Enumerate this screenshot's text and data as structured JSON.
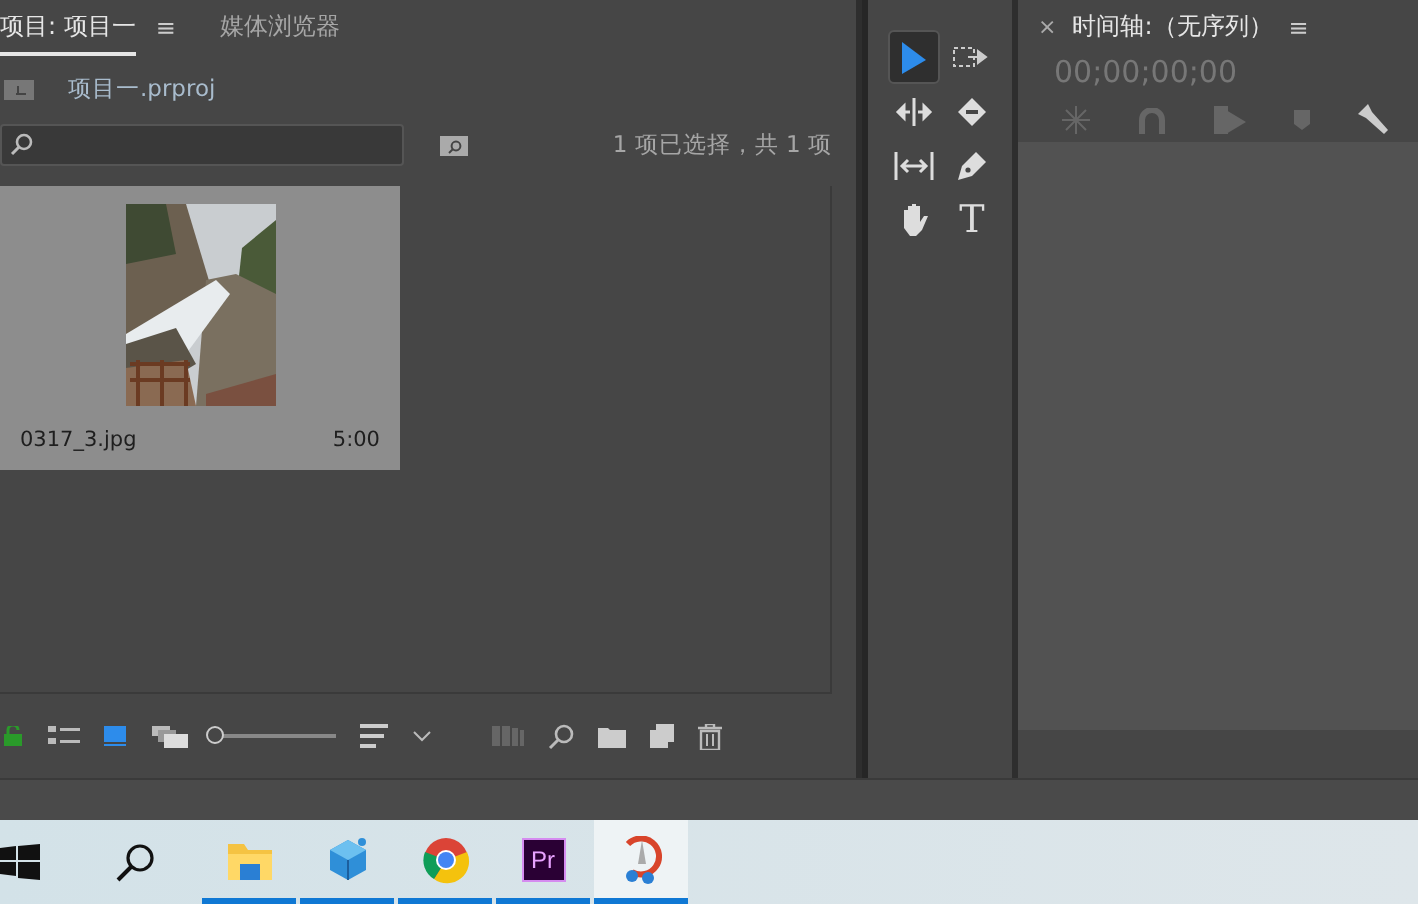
{
  "project_panel": {
    "tabs": [
      {
        "label": "项目: 项目一",
        "selected": true,
        "menu": "≡"
      },
      {
        "label": "媒体浏览器",
        "selected": false
      }
    ],
    "path": "项目一.prproj",
    "selection_status": "1 项已选择，共 1 项",
    "items": [
      {
        "kind": "picture",
        "name": "0317_3.jpg",
        "duration": "5:00",
        "selected": true
      }
    ],
    "zoom": {
      "level": 0.05
    }
  },
  "tools": [
    {
      "kind": "selection",
      "selected": true
    },
    {
      "kind": "track",
      "selected": false
    },
    {
      "kind": "ripple",
      "selected": false
    },
    {
      "kind": "razor",
      "selected": false
    },
    {
      "kind": "slip",
      "selected": false
    },
    {
      "kind": "pen",
      "selected": false
    },
    {
      "kind": "hand",
      "selected": false
    },
    {
      "kind": "type",
      "selected": false,
      "glyph": "T"
    }
  ],
  "timeline": {
    "close": "×",
    "title": "时间轴:（无序列）",
    "menu": "≡",
    "timecode": "00;00;00;00"
  },
  "taskbar": {
    "apps": [
      {
        "kind": "explorer",
        "running": true,
        "selected": false
      },
      {
        "kind": "cube",
        "running": true,
        "selected": false
      },
      {
        "kind": "chrome",
        "running": true,
        "selected": false
      },
      {
        "kind": "premiere",
        "label": "Pr",
        "running": true,
        "selected": false
      },
      {
        "kind": "snip",
        "running": true,
        "selected": true
      }
    ]
  }
}
